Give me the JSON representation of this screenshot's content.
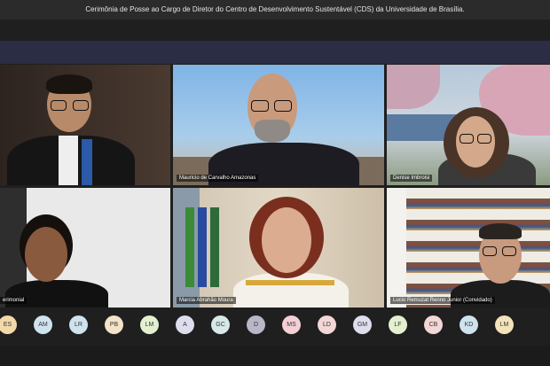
{
  "window": {
    "title": "Cerimônia de Posse ao Cargo de Diretor do Centro de Desenvolvimento Sustentável (CDS) da Universidade de Brasília."
  },
  "participants": [
    {
      "name": ""
    },
    {
      "name": "Mauricio de Carvalho Amazonas"
    },
    {
      "name": "Denise Imbroisi"
    },
    {
      "name": "erimonial"
    },
    {
      "name": "Marcia Abrahão Moura"
    },
    {
      "name": "Lucio Remuzat Renno Junior (Convidado)"
    }
  ],
  "avatars": [
    {
      "initials": "ES",
      "color": "#f3d9a8"
    },
    {
      "initials": "AM",
      "color": "#cfe3ee"
    },
    {
      "initials": "LR",
      "color": "#cfe3ee"
    },
    {
      "initials": "PB",
      "color": "#f3e3c8"
    },
    {
      "initials": "LM",
      "color": "#e3f0d0"
    },
    {
      "initials": "A",
      "color": "#ddddee"
    },
    {
      "initials": "GC",
      "color": "#d8e8e8"
    },
    {
      "initials": "D",
      "color": "#b7b7c8"
    },
    {
      "initials": "MS",
      "color": "#f3d0d6"
    },
    {
      "initials": "LD",
      "color": "#f3d6d6"
    },
    {
      "initials": "GM",
      "color": "#ddddee"
    },
    {
      "initials": "LF",
      "color": "#e3f0d0"
    },
    {
      "initials": "CB",
      "color": "#f3d6d6"
    },
    {
      "initials": "KD",
      "color": "#cfe3ee"
    },
    {
      "initials": "LM",
      "color": "#f3e3b8"
    }
  ]
}
